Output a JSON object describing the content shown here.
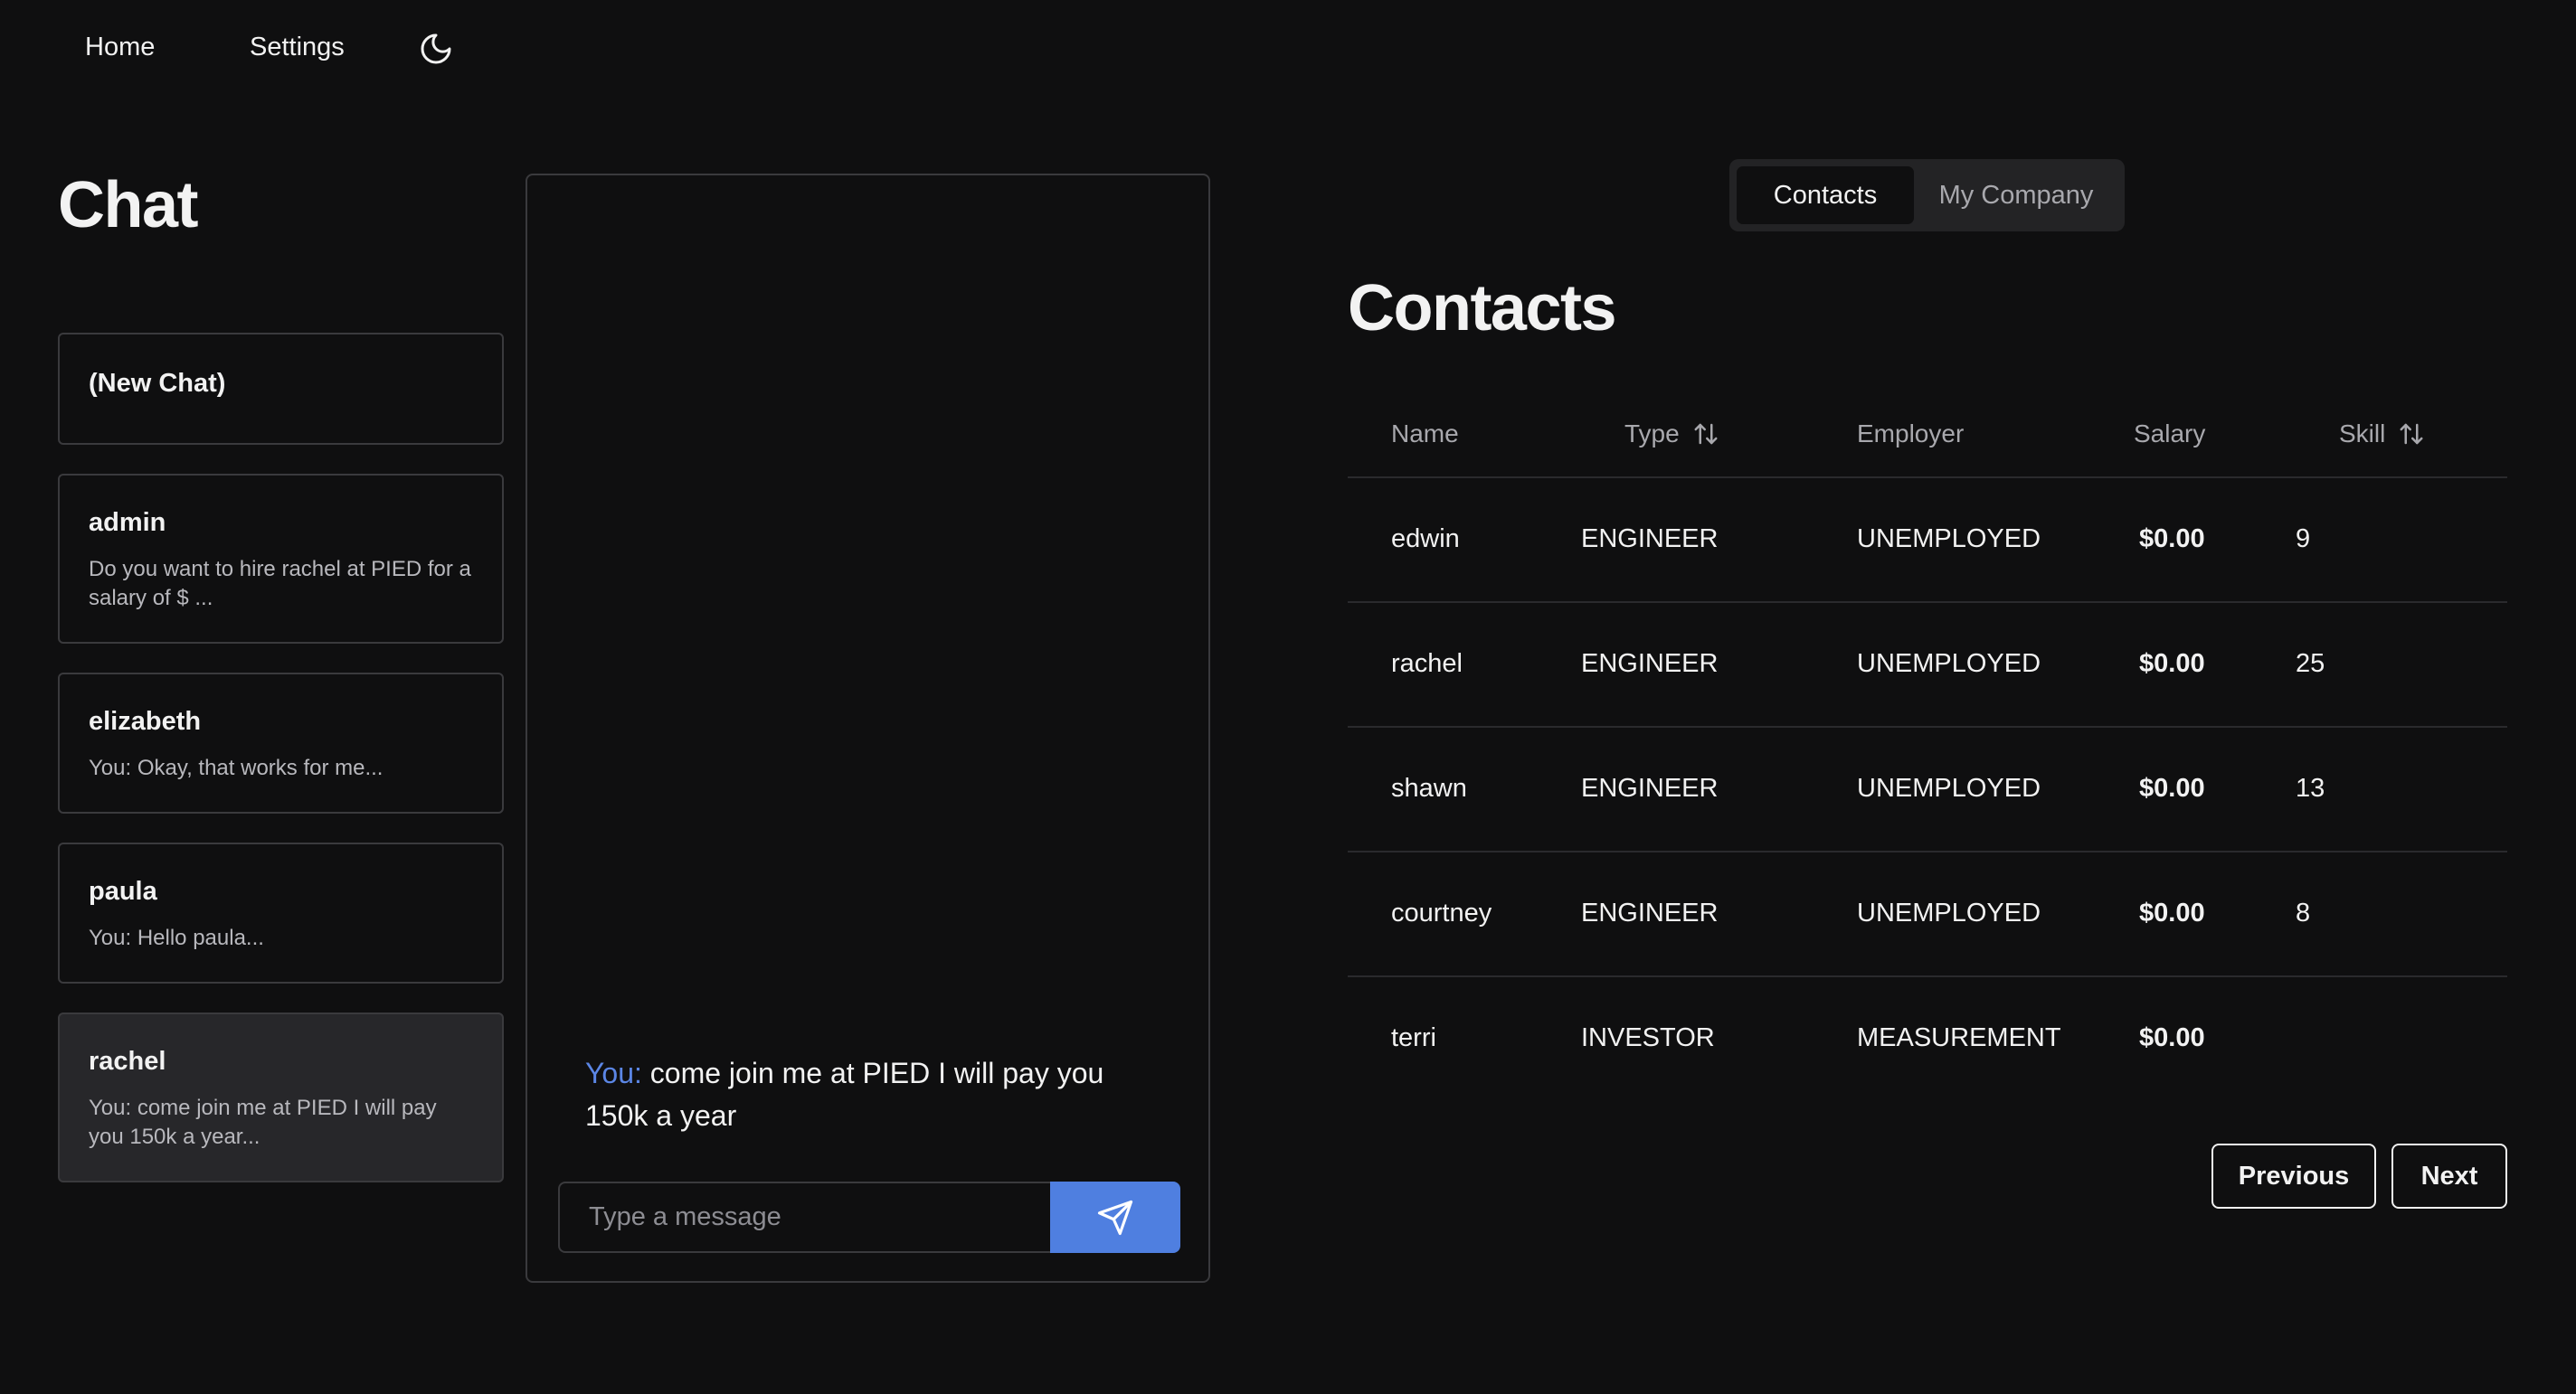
{
  "nav": {
    "home": "Home",
    "settings": "Settings",
    "theme_icon": "moon-icon"
  },
  "chat": {
    "title": "Chat",
    "conversations": [
      {
        "name": "(New Chat)",
        "preview": ""
      },
      {
        "name": "admin",
        "preview": "Do you want to hire rachel at PIED for a salary of $ ..."
      },
      {
        "name": "elizabeth",
        "preview": "You: Okay, that works for me..."
      },
      {
        "name": "paula",
        "preview": "You: Hello paula..."
      },
      {
        "name": "rachel",
        "preview": "You: come join me at PIED I will pay you 150k a year..."
      }
    ],
    "active_conversation": "rachel",
    "messages": [
      {
        "sender": "You:",
        "text": "come join me at PIED I will pay you 150k a year"
      }
    ],
    "input_placeholder": "Type a message",
    "send_icon": "send-icon",
    "sender_color": "#5b86e5",
    "send_button_color": "#4f7fe0"
  },
  "tabs": {
    "contacts": "Contacts",
    "my_company": "My Company",
    "active": "Contacts"
  },
  "contacts": {
    "title": "Contacts",
    "columns": {
      "name": "Name",
      "type": "Type",
      "employer": "Employer",
      "salary": "Salary",
      "skill": "Skill"
    },
    "sort_icon": "sort-arrows-icon",
    "rows": [
      {
        "name": "edwin",
        "type": "ENGINEER",
        "employer": "UNEMPLOYED",
        "salary": "$0.00",
        "skill": "9"
      },
      {
        "name": "rachel",
        "type": "ENGINEER",
        "employer": "UNEMPLOYED",
        "salary": "$0.00",
        "skill": "25"
      },
      {
        "name": "shawn",
        "type": "ENGINEER",
        "employer": "UNEMPLOYED",
        "salary": "$0.00",
        "skill": "13"
      },
      {
        "name": "courtney",
        "type": "ENGINEER",
        "employer": "UNEMPLOYED",
        "salary": "$0.00",
        "skill": "8"
      },
      {
        "name": "terri",
        "type": "INVESTOR",
        "employer": "MEASUREMENT",
        "salary": "$0.00",
        "skill": ""
      }
    ],
    "pagination": {
      "previous": "Previous",
      "next": "Next"
    }
  }
}
